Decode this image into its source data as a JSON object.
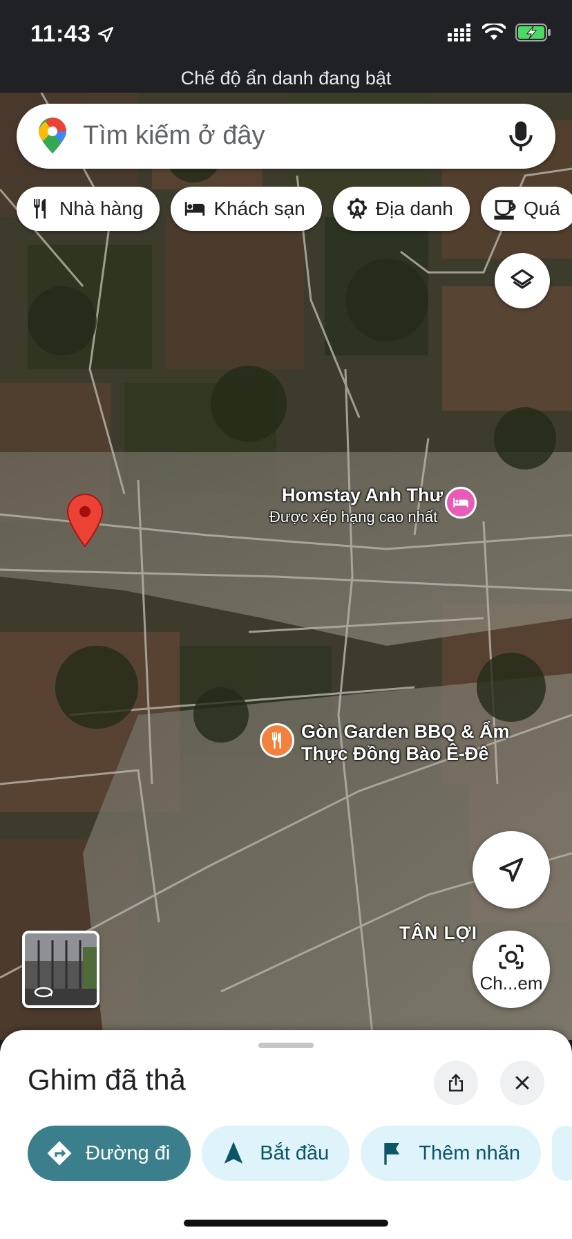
{
  "status_bar": {
    "time": "11:43",
    "incognito_notice": "Chế độ ẩn danh đang bật"
  },
  "search": {
    "placeholder": "Tìm kiếm ở đây",
    "pin_icon": "google-maps-pin-icon",
    "mic_icon": "microphone-icon"
  },
  "chips": [
    {
      "label": "Nhà hàng",
      "icon": "restaurant-icon"
    },
    {
      "label": "Khách sạn",
      "icon": "hotel-icon"
    },
    {
      "label": "Địa danh",
      "icon": "attraction-icon"
    },
    {
      "label": "Quá",
      "icon": "coffee-icon"
    }
  ],
  "map": {
    "pois": [
      {
        "name": "Homstay Anh Thư",
        "sub": "Được xếp hạng cao nhất",
        "icon": "hotel-icon",
        "color": "#e85bb7"
      },
      {
        "name_line1": "Gòn Garden BBQ & Ẩm",
        "name_line2": "Thực Đồng Bào Ê-Đê",
        "icon": "restaurant-icon",
        "color": "#f1813d"
      }
    ],
    "area_label": "TÂN LỢI",
    "dropped_pin_color": "#ea4335",
    "lens_label": "Ch...em"
  },
  "sheet": {
    "title": "Ghim đã thả",
    "actions": [
      {
        "label": "Đường đi",
        "icon": "directions-icon"
      },
      {
        "label": "Bắt đầu",
        "icon": "navigation-arrow-icon"
      },
      {
        "label": "Thêm nhãn",
        "icon": "flag-icon"
      }
    ]
  },
  "colors": {
    "primary_action": "#3b7e8c",
    "secondary_action_bg": "#dff3fb",
    "secondary_action_text": "#0b5666"
  }
}
